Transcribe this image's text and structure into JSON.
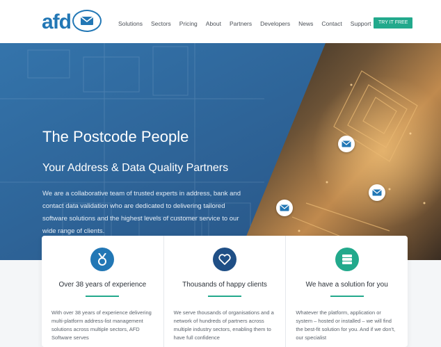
{
  "logo": {
    "text": "afd"
  },
  "nav": {
    "items": [
      "Solutions",
      "Sectors",
      "Pricing",
      "About",
      "Partners",
      "Developers",
      "News",
      "Contact",
      "Support"
    ],
    "cta": "TRY IT FREE"
  },
  "hero": {
    "title": "The Postcode People",
    "subtitle": "Your Address & Data Quality Partners",
    "body": "We are a collaborative team of trusted experts in address, bank and contact data validation who are dedicated to delivering tailored software solutions and the highest levels of customer service to our wide range of clients."
  },
  "cards": [
    {
      "icon": "medal-icon",
      "icon_color": "#2277b5",
      "title": "Over 38 years of experience",
      "body": "With over 38 years of experience delivering multi-platform address-list management solutions across multiple sectors, AFD Software serves"
    },
    {
      "icon": "heart-icon",
      "icon_color": "#1f4f86",
      "title": "Thousands of happy clients",
      "body": "We serve thousands of organisations and a network of hundreds of partners across multiple industry sectors, enabling them to have full confidence"
    },
    {
      "icon": "server-icon",
      "icon_color": "#22a98c",
      "title": "We have a solution for you",
      "body": "Whatever the platform, application or system – hosted or installed – we will find the best-fit solution for you. And if we don't, our specialist"
    }
  ],
  "colors": {
    "brand_blue": "#2277b5",
    "accent_green": "#22a98c"
  }
}
